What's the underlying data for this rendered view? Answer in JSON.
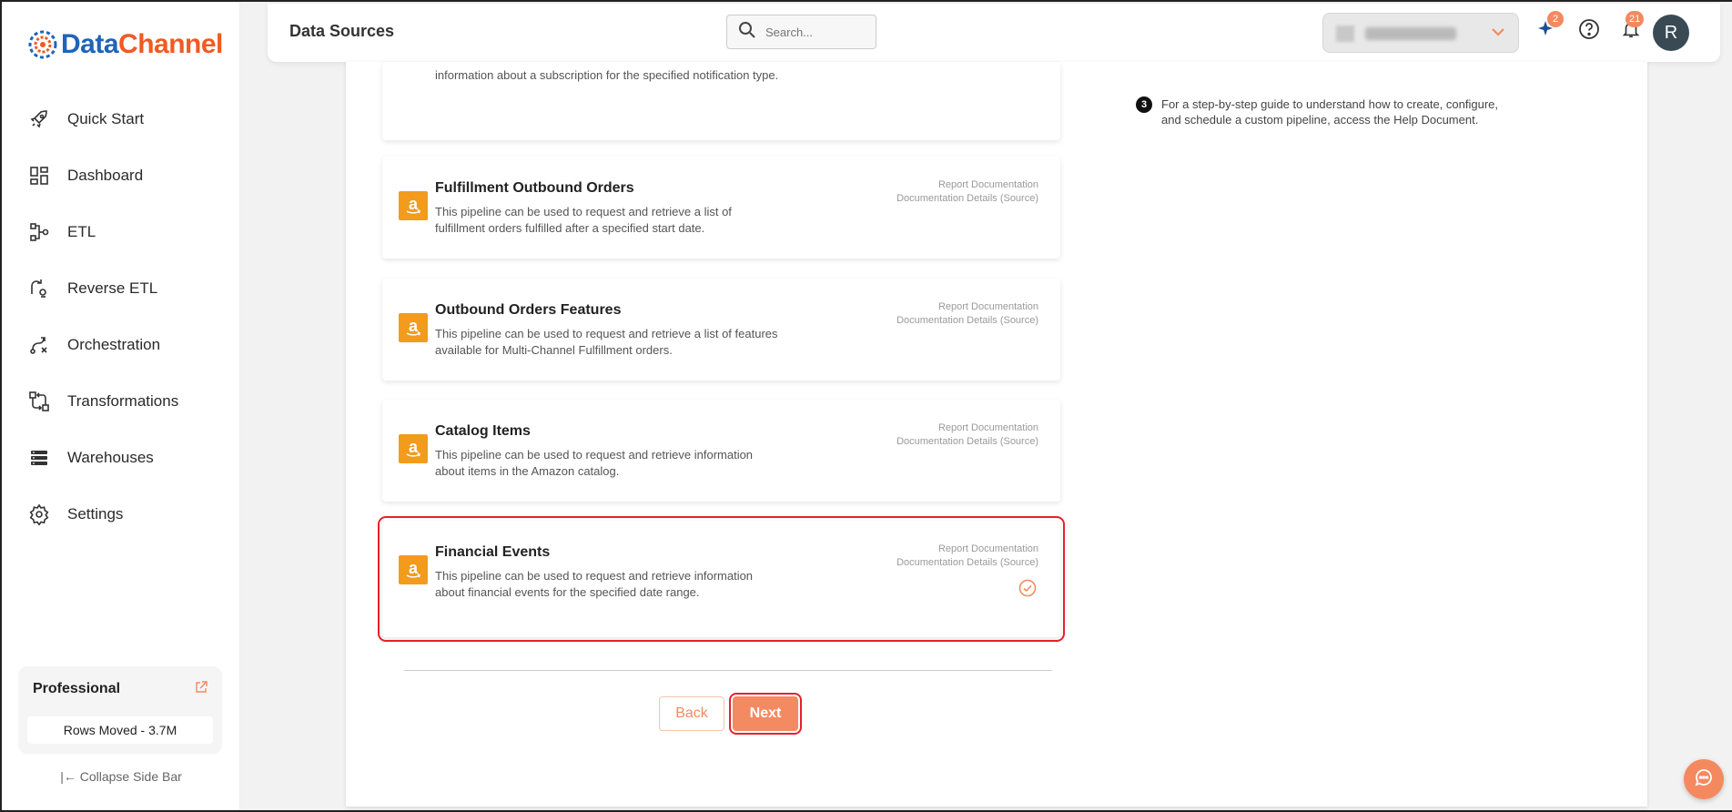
{
  "brand": {
    "part1": "Data",
    "part2": "Channel"
  },
  "sidebar": {
    "items": [
      {
        "label": "Quick Start",
        "icon": "rocket-icon"
      },
      {
        "label": "Dashboard",
        "icon": "dashboard-icon"
      },
      {
        "label": "ETL",
        "icon": "etl-icon"
      },
      {
        "label": "Reverse ETL",
        "icon": "reverse-etl-icon"
      },
      {
        "label": "Orchestration",
        "icon": "orchestration-icon"
      },
      {
        "label": "Transformations",
        "icon": "transformations-icon"
      },
      {
        "label": "Warehouses",
        "icon": "warehouses-icon"
      },
      {
        "label": "Settings",
        "icon": "gear-icon"
      }
    ],
    "plan": {
      "title": "Professional",
      "rows_moved": "Rows Moved - 3.7M"
    },
    "collapse_label": "|← Collapse Side Bar"
  },
  "header": {
    "title": "Data Sources",
    "search_placeholder": "Search...",
    "sparkle_badge": "2",
    "notification_badge": "21",
    "avatar_initial": "R"
  },
  "pipelines": [
    {
      "title": "",
      "desc": "information about a subscription for the specified notification type.",
      "partial": true
    },
    {
      "title": "Fulfillment Outbound Orders",
      "desc": "This pipeline can be used to request and retrieve a list of fulfillment orders fulfilled after a specified start date.",
      "link1": "Report Documentation",
      "link2": "Documentation Details (Source)"
    },
    {
      "title": "Outbound Orders Features",
      "desc": "This pipeline can be used to request and retrieve a list of features available for Multi-Channel Fulfillment orders.",
      "link1": "Report Documentation",
      "link2": "Documentation Details (Source)"
    },
    {
      "title": "Catalog Items",
      "desc": "This pipeline can be used to request and retrieve information about items in the Amazon catalog.",
      "link1": "Report Documentation",
      "link2": "Documentation Details (Source)"
    },
    {
      "title": "Financial Events",
      "desc": "This pipeline can be used to request and retrieve information about financial events for the specified date range.",
      "link1": "Report Documentation",
      "link2": "Documentation Details (Source)",
      "selected": true
    }
  ],
  "buttons": {
    "back": "Back",
    "next": "Next"
  },
  "help": {
    "step_number": "3",
    "text": "For a step-by-step guide to understand how to create, configure, and schedule a custom pipeline, access the Help Document."
  },
  "colors": {
    "accent": "#f4895f",
    "brand_blue": "#1f64b8",
    "brand_orange": "#f05a22",
    "amazon": "#f29b1d",
    "selected_outline": "#e8202a"
  }
}
